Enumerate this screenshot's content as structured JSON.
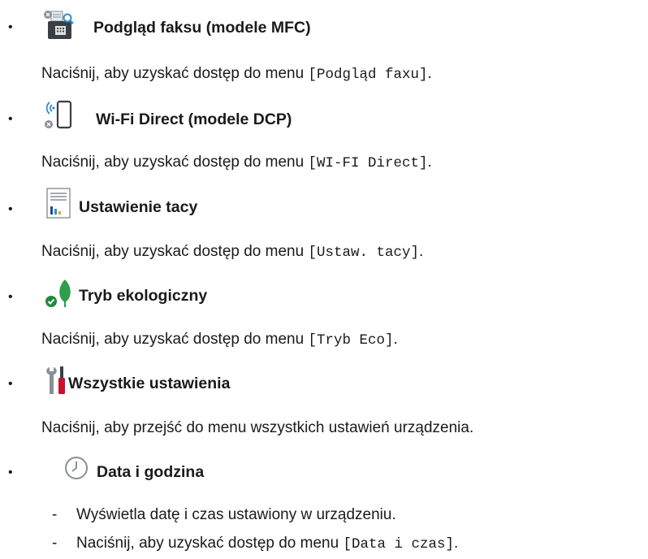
{
  "items": [
    {
      "bullet": "•",
      "icon": "fax-preview-icon",
      "title": "Podgląd faksu (modele MFC)",
      "desc_prefix": "Naciśnij, aby uzyskać dostęp do menu ",
      "desc_menu": "[Podgląd faxu]",
      "desc_suffix": "."
    },
    {
      "bullet": "•",
      "icon": "wifi-direct-icon",
      "title": "Wi-Fi Direct (modele DCP)",
      "desc_prefix": "Naciśnij, aby uzyskać dostęp do menu ",
      "desc_menu": "[WI-FI Direct]",
      "desc_suffix": "."
    },
    {
      "bullet": "•",
      "icon": "tray-settings-icon",
      "title": "Ustawienie tacy",
      "desc_prefix": "Naciśnij, aby uzyskać dostęp do menu ",
      "desc_menu": "[Ustaw. tacy]",
      "desc_suffix": "."
    },
    {
      "bullet": "•",
      "icon": "eco-leaf-icon",
      "title": "Tryb ekologiczny",
      "desc_prefix": "Naciśnij, aby uzyskać dostęp do menu ",
      "desc_menu": "[Tryb Eco]",
      "desc_suffix": "."
    },
    {
      "bullet": "•",
      "icon": "tools-icon",
      "title": "Wszystkie ustawienia",
      "desc_prefix": "Naciśnij, aby przejść do menu wszystkich ustawień urządzenia."
    },
    {
      "bullet": "•",
      "icon": "clock-icon",
      "title": "Data i godzina",
      "sub": [
        {
          "dash": "-",
          "text": "Wyświetla datę i czas ustawiony w urządzeniu."
        },
        {
          "dash": "-",
          "prefix": "Naciśnij, aby uzyskać dostęp do menu ",
          "menu": "[Data i czas]",
          "suffix": "."
        }
      ]
    }
  ],
  "colors": {
    "tray_blue": "#2f8fd0",
    "leaf_green": "#2e9e4a",
    "check_green": "#1f8a3a",
    "tool_red": "#c8102e",
    "icon_gray": "#8a8f96",
    "dark_gray": "#3b3f45"
  }
}
